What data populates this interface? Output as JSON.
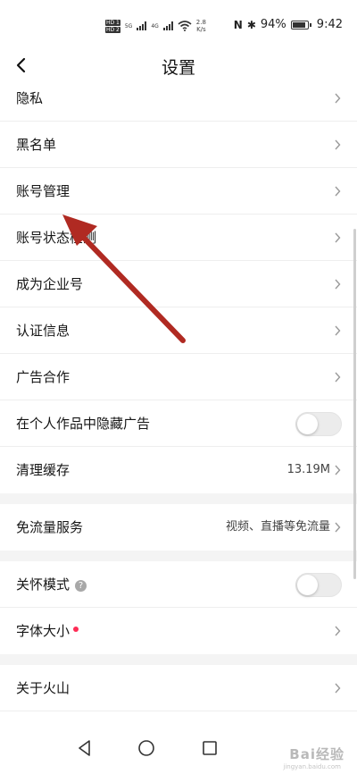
{
  "status_bar": {
    "hd1": "HD 1",
    "hd2": "HD 2",
    "signal1": "5G",
    "signal2": "4G",
    "speed_value": "2.8",
    "speed_unit": "K/s",
    "nfc": "N",
    "bluetooth": "✱",
    "battery_percent": "94%",
    "battery_level": 0.94,
    "time": "9:42"
  },
  "header": {
    "title": "设置",
    "back_icon": "back-chevron"
  },
  "settings": {
    "privacy": "隐私",
    "blacklist": "黑名单",
    "account_management": "账号管理",
    "account_status_check": "账号状态检测",
    "become_enterprise": "成为企业号",
    "certification": "认证信息",
    "ad_cooperation": "广告合作",
    "hide_ads": "在个人作品中隐藏广告",
    "clear_cache": "清理缓存",
    "cache_size": "13.19M",
    "free_data": "免流量服务",
    "free_data_desc": "视频、直播等免流量",
    "care_mode": "关怀模式",
    "care_mode_help": "?",
    "font_size": "字体大小",
    "about": "关于火山"
  },
  "toggles": {
    "hide_ads_on": false,
    "care_mode_on": false
  },
  "nav": {
    "back": "triangle-back-icon",
    "home": "circle-home-icon",
    "recents": "square-recents-icon"
  },
  "watermark": {
    "text": "Bai经验",
    "sub": "jingyan.baidu.com"
  },
  "colors": {
    "accent_red": "#fe2c55",
    "annotation_arrow": "#b02a22"
  }
}
